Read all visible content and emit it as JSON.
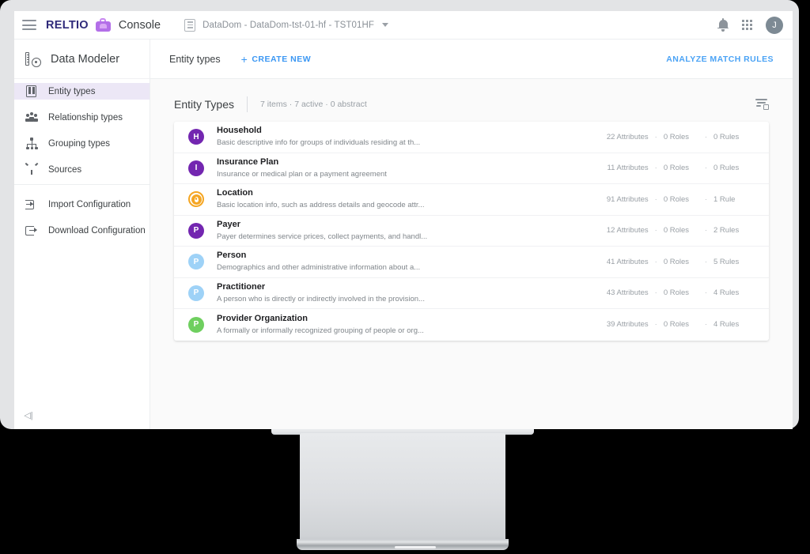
{
  "topbar": {
    "menu_icon": "hamburger-icon",
    "brand": "RELTIO",
    "app_icon": "briefcase-icon",
    "product": "Console",
    "tenant": "DataDom - DataDom-tst-01-hf - TST01HF",
    "tenant_icon": "document-icon",
    "tenant_caret": "chevron-down-icon",
    "notifications_icon": "bell-icon",
    "apps_icon": "apps-grid-icon",
    "avatar_initial": "J"
  },
  "sidebar": {
    "app_title": "Data Modeler",
    "app_icon": "data-modeler-icon",
    "items": [
      {
        "label": "Entity types",
        "icon": "entity-types-icon",
        "active": true
      },
      {
        "label": "Relationship types",
        "icon": "relationship-types-icon",
        "active": false
      },
      {
        "label": "Grouping types",
        "icon": "grouping-types-icon",
        "active": false
      },
      {
        "label": "Sources",
        "icon": "sources-icon",
        "active": false
      }
    ],
    "config_items": [
      {
        "label": "Import Configuration",
        "icon": "import-configuration-icon"
      },
      {
        "label": "Download Configuration",
        "icon": "download-configuration-icon"
      }
    ],
    "collapse_glyph": "◁|"
  },
  "content_header": {
    "title": "Entity types",
    "create_new": "CREATE NEW",
    "create_new_plus": "+",
    "analyze_match_rules": "ANALYZE MATCH RULES"
  },
  "section": {
    "title": "Entity Types",
    "meta": "7 items · 7 active · 0 abstract",
    "filter_icon": "filter-sort-icon"
  },
  "entity_types": [
    {
      "badge": "H",
      "badge_color": "#7326b0",
      "badge_style": "solid",
      "name": "Household",
      "description": "Basic descriptive info for groups of individuals residing at th...",
      "attributes": "22 Attributes",
      "roles": "0 Roles",
      "rules": "0 Rules"
    },
    {
      "badge": "I",
      "badge_color": "#7326b0",
      "badge_style": "solid",
      "name": "Insurance Plan",
      "description": "Insurance or medical plan or a payment agreement",
      "attributes": "11 Attributes",
      "roles": "0 Roles",
      "rules": "0 Rules"
    },
    {
      "badge": "",
      "badge_color": "#f5a623",
      "badge_style": "ring-pin",
      "name": "Location",
      "description": "Basic location info, such as address details and geocode attr...",
      "attributes": "91 Attributes",
      "roles": "0 Roles",
      "rules": "1 Rule"
    },
    {
      "badge": "P",
      "badge_color": "#7326b0",
      "badge_style": "solid",
      "name": "Payer",
      "description": "Payer determines service prices, collect payments, and handl...",
      "attributes": "12 Attributes",
      "roles": "0 Roles",
      "rules": "2 Rules"
    },
    {
      "badge": "P",
      "badge_color": "#9ed2f7",
      "badge_style": "solid",
      "name": "Person",
      "description": "Demographics and other administrative information about a...",
      "attributes": "41 Attributes",
      "roles": "0 Roles",
      "rules": "5 Rules"
    },
    {
      "badge": "P",
      "badge_color": "#9ed2f7",
      "badge_style": "solid",
      "name": "Practitioner",
      "description": "A person who is directly or indirectly involved in the provision...",
      "attributes": "43 Attributes",
      "roles": "0 Roles",
      "rules": "4 Rules"
    },
    {
      "badge": "P",
      "badge_color": "#6fcf5f",
      "badge_style": "solid",
      "name": "Provider Organization",
      "description": "A formally or informally recognized grouping of people or org...",
      "attributes": "39 Attributes",
      "roles": "0 Roles",
      "rules": "4 Rules"
    }
  ],
  "colors": {
    "brand_purple": "#2f2a7a",
    "accent_blue": "#3b97f3",
    "active_nav_bg": "#ece7f6",
    "page_bg": "#fafafa"
  },
  "separator": "·"
}
